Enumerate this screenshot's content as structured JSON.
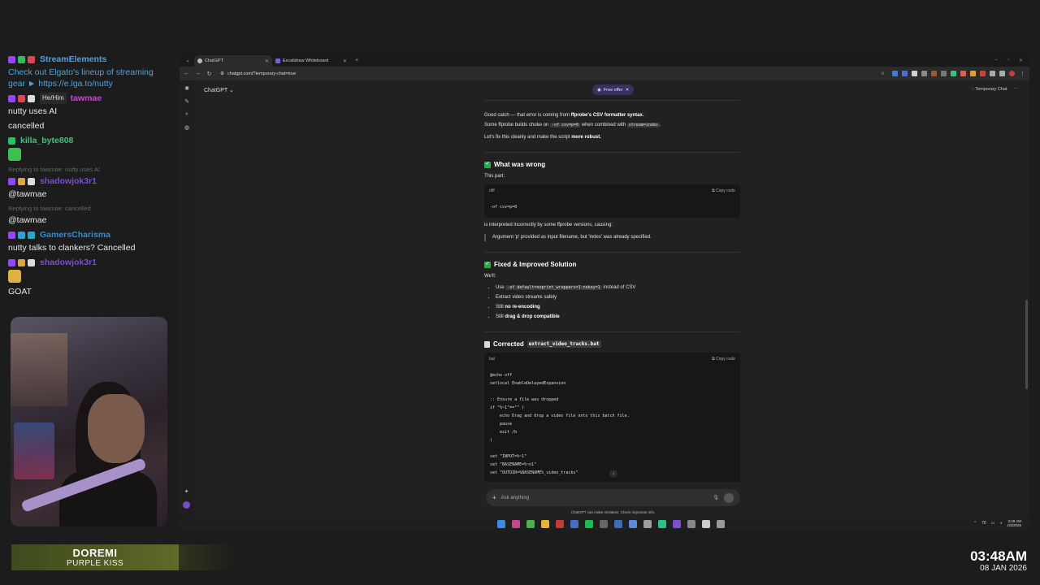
{
  "chat": {
    "messages": [
      {
        "user": "StreamElements",
        "user_color": "#4aa3df",
        "badges": [
          "purple",
          "green",
          "red"
        ],
        "text": "Check out Elgato's lineup of streaming gear ► https://e.lga.to/nutty",
        "text_color": "#4aa3df"
      },
      {
        "user": "tawmae",
        "user_color": "#d43fe0",
        "badges": [
          "purple",
          "red",
          "white"
        ],
        "pronoun": "He/Him",
        "text": "nutty uses AI"
      },
      {
        "user": "",
        "text": "cancelled"
      },
      {
        "user": "killa_byte808",
        "user_color": "#43c07a",
        "badges": [
          "green"
        ],
        "text": ""
      },
      {
        "user": "shadowjok3r1",
        "user_color": "#7b4ed3",
        "badges": [
          "purple",
          "gold",
          "white"
        ],
        "reply": "Replying to tawmae: nutty uses AI",
        "text": "@tawmae"
      },
      {
        "user": "",
        "reply": "Replying to tawmae: cancelled",
        "text": "@tawmae"
      },
      {
        "user": "GamersCharisma",
        "user_color": "#2c8ed6",
        "badges": [
          "purple",
          "teal",
          "teal"
        ],
        "text": "nutty talks to clankers? Cancelled"
      },
      {
        "user": "shadowjok3r1",
        "user_color": "#7b4ed3",
        "badges": [
          "purple",
          "gold",
          "white"
        ],
        "text": ""
      },
      {
        "user": "",
        "text": "GOAT"
      }
    ]
  },
  "now_playing": {
    "title": "DOREMI",
    "artist": "PURPLE KISS"
  },
  "clock": {
    "time": "03:48AM",
    "date": "08 JAN 2026"
  },
  "browser": {
    "tabs": [
      {
        "label": "ChatGPT",
        "active": true
      },
      {
        "label": "Excalidraw Whiteboard",
        "active": false
      }
    ],
    "url": "chatgpt.com/?temporary-chat=true"
  },
  "app": {
    "model": "ChatGPT",
    "free_offer": "Free offer",
    "temp_chat": "Temporary Chat",
    "composer_placeholder": "Ask anything",
    "disclaimer": "ChatGPT can make mistakes. Check important info."
  },
  "response": {
    "p1_a": "Good catch — that error is coming from ",
    "p1_b": "ffprobe's CSV formatter syntax.",
    "p2_a": "Some ffprobe builds choke on ",
    "p2_code1": "-of csv=p=0",
    "p2_b": " when combined with ",
    "p2_code2": "stream=index",
    "p2_c": ".",
    "p3_a": "Let's fix this cleanly and make the script ",
    "p3_b": "more robust.",
    "h_wrong": "What was wrong",
    "this_part": "This part:",
    "diff_label": "diff",
    "copy_code": "Copy code",
    "diff_code": "-of csv=p=0",
    "interp": "is interpreted incorrectly by some ffprobe versions, causing:",
    "quote": "Argument 'p' provided as input filename, but 'index' was already specified.",
    "h_fixed": "Fixed & Improved Solution",
    "well": "We'll:",
    "li1_a": "Use ",
    "li1_code": "-of default=noprint_wrappers=1:nokey=1",
    "li1_b": " instead of CSV",
    "li2": "Extract video streams safely",
    "li3_a": "Still ",
    "li3_b": "no re-encoding",
    "li4_a": "Still ",
    "li4_b": "drag & drop compatible",
    "h_corrected": "Corrected",
    "corrected_file": "extract_video_tracks.bat",
    "bat_label": "bat",
    "bat_code": "@echo off\nsetlocal EnableDelayedExpansion\n\n:: Ensure a file was dropped\nif \"%~1\"==\"\" (\n    echo Drag and drop a video file onto this batch file.\n    pause\n    exit /b\n)\n\nset \"INPUT=%~1\"\nset \"BASENAME=%~n1\"\nset \"OUTDIR=%BASENAME%_video_tracks\""
  },
  "tray": {
    "temp": "70",
    "time": "3:48 AM",
    "date": "1/8/2026"
  }
}
